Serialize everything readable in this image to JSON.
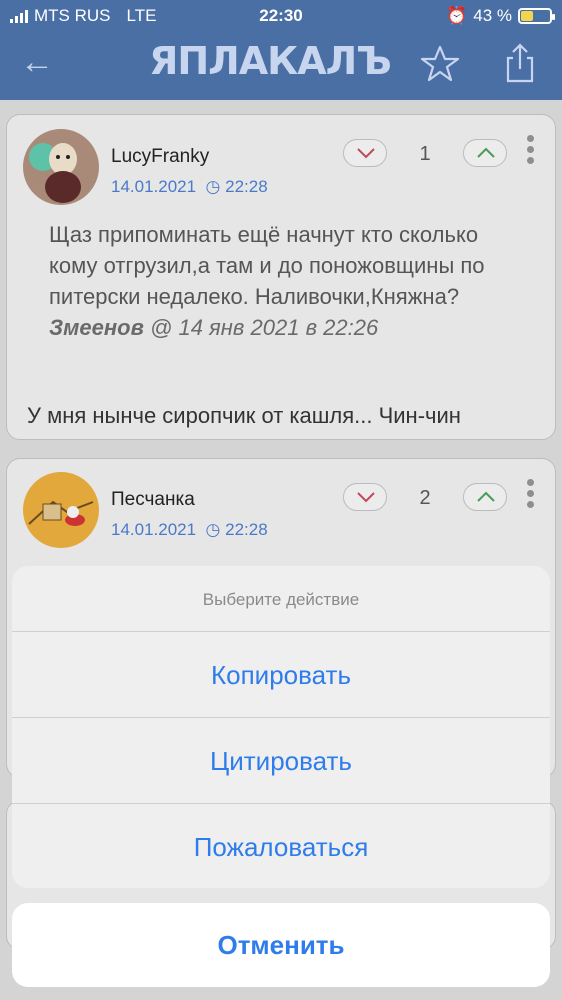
{
  "status": {
    "carrier": "MTS RUS",
    "network": "LTE",
    "time": "22:30",
    "battery": "43 %",
    "battery_level": 0.43
  },
  "header": {
    "logo": "ЯПЛАКАЛЪ",
    "back_icon": "arrow-left-icon",
    "star_icon": "star-icon",
    "share_icon": "share-icon"
  },
  "posts": [
    {
      "author": "LucyFranky",
      "date": "14.01.2021",
      "time": "22:28",
      "rating": "1",
      "quote_text": "Щаз припоминать ещё начнут кто сколько кому отгрузил,а там и до поножовщины по питерски недалеко. Наливочки,Княжна?",
      "quote_author": "Змеенов",
      "quote_meta": "@ 14 янв 2021 в 22:26",
      "text": "У мня нынче сиропчик от кашля... Чин-чин"
    },
    {
      "author": "Песчанка",
      "date": "14.01.2021",
      "time": "22:28",
      "rating": "2"
    }
  ],
  "action_sheet": {
    "title": "Выберите действие",
    "items": [
      "Копировать",
      "Цитировать",
      "Пожаловаться"
    ],
    "cancel": "Отменить"
  },
  "colors": {
    "header": "#4a6fa5",
    "accent": "#2f7dea",
    "date": "#4a79c9"
  }
}
